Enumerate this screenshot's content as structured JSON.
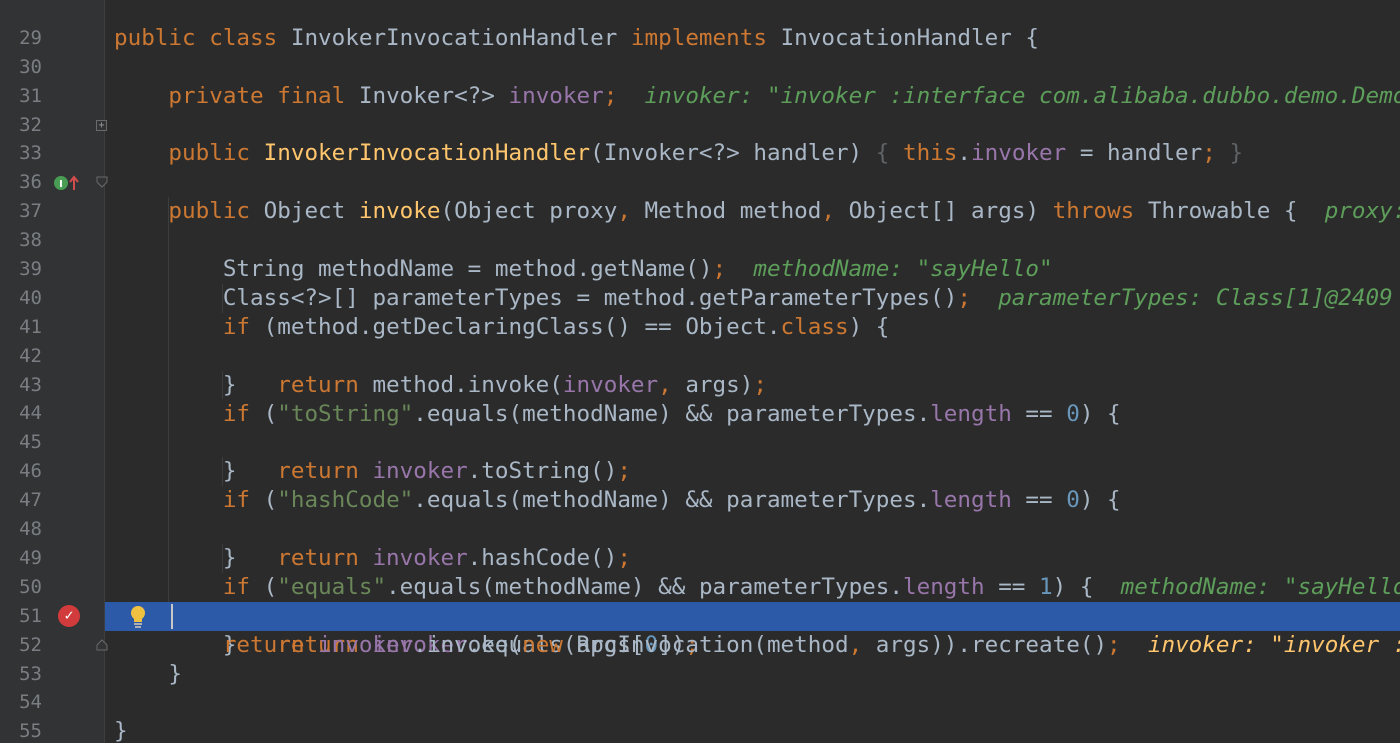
{
  "editor": {
    "language": "Java",
    "theme_colors": {
      "background": "#2b2b2b",
      "gutter": "#313335",
      "keyword": "#cc7832",
      "method_decl": "#ffc66d",
      "field": "#9876aa",
      "string": "#6a8759",
      "number": "#6897bb",
      "inline_hint": "#5d9e5a",
      "execution_line": "#2c59a8"
    },
    "top_partial_text": "}",
    "line_numbers": [
      "29",
      "30",
      "31",
      "32",
      "33",
      "36",
      "37",
      "38",
      "39",
      "40",
      "41",
      "42",
      "43",
      "44",
      "45",
      "46",
      "47",
      "48",
      "49",
      "50",
      "51",
      "52",
      "53",
      "54",
      "55"
    ],
    "hints": {
      "invoker": "invoker: \"invoker :interface com.alibaba.dubbo.demo.Demo",
      "proxy": "proxy:",
      "methodName": "methodName: \"sayHello\"",
      "parameterTypes": "parameterTypes: Class[1]@2409",
      "methodName_cut": "methodName: \"sayHello",
      "invoker_exec": "invoker: \"invoker :"
    },
    "gutter_icons": {
      "line_37": "implements-method-icon",
      "line_52_breakpoint": "breakpoint-icon",
      "line_52_intention": "lightbulb-icon"
    },
    "execution_line": "52"
  }
}
